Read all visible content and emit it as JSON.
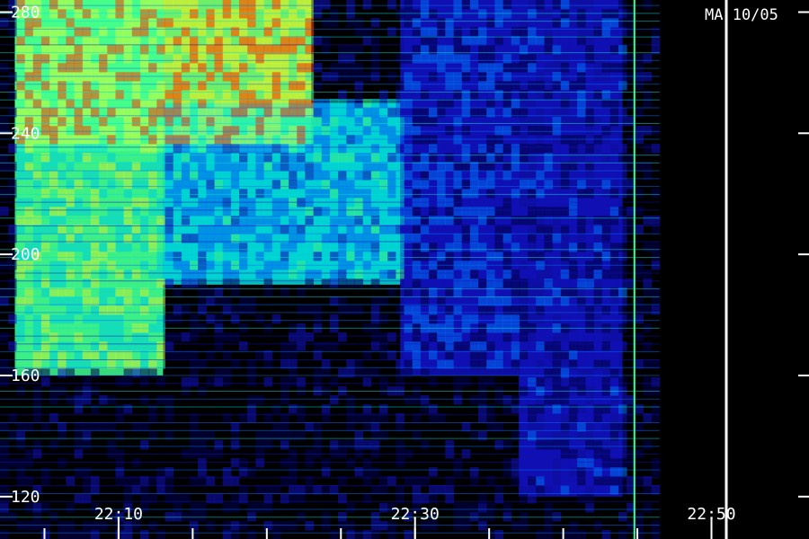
{
  "chart_data": {
    "type": "heatmap",
    "corner_label": "MA 10/05",
    "x": {
      "start_minutes": 1322,
      "end_minutes": 1371,
      "major_ticks": [
        {
          "value": 1330,
          "label": "22:10"
        },
        {
          "value": 1350,
          "label": "22:30"
        },
        {
          "value": 1370,
          "label": "22:50"
        }
      ],
      "minor_step": 5
    },
    "y": {
      "ylim": [
        106,
        284
      ],
      "ticks": [
        {
          "value": 120,
          "label": "120"
        },
        {
          "value": 160,
          "label": "160"
        },
        {
          "value": 200,
          "label": "200"
        },
        {
          "value": 240,
          "label": "240"
        },
        {
          "value": 280,
          "label": "280"
        }
      ]
    },
    "colormap": [
      "#000000",
      "#000050",
      "#1010c0",
      "#0070ff",
      "#00e0e0",
      "#40ff90",
      "#c8ff40",
      "#ff4000"
    ],
    "intensity_regions": [
      {
        "t0": 1323,
        "t1": 1343,
        "f0": 234,
        "f1": 284,
        "level": 0.85
      },
      {
        "t0": 1323,
        "t1": 1333,
        "f0": 160,
        "f1": 284,
        "level": 0.7
      },
      {
        "t0": 1333,
        "t1": 1349,
        "f0": 190,
        "f1": 250,
        "level": 0.5
      },
      {
        "t0": 1349,
        "t1": 1357,
        "f0": 160,
        "f1": 284,
        "level": 0.3
      },
      {
        "t0": 1357,
        "t1": 1364,
        "f0": 120,
        "f1": 284,
        "level": 0.22
      }
    ],
    "vertical_lines": [
      1364.8
    ],
    "data_end_minutes": 1366.5
  }
}
